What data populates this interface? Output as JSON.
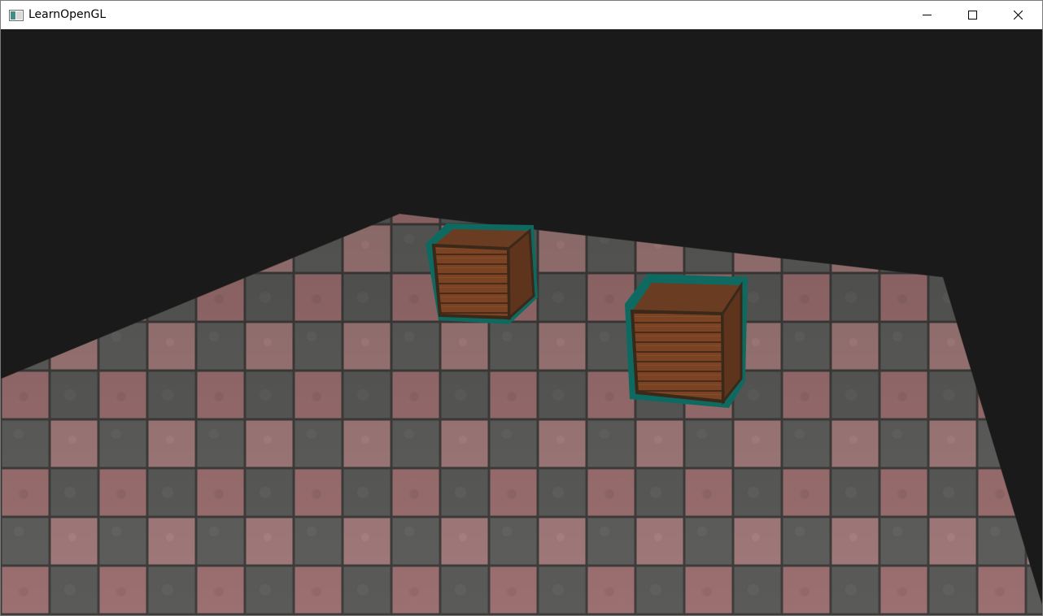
{
  "window": {
    "title": "LearnOpenGL",
    "icon": "app-window-icon",
    "controls": [
      "minimize-icon",
      "maximize-icon",
      "close-icon"
    ]
  },
  "scene": {
    "clear_color": "#1a1a1a",
    "outline_color": "#0e6a60",
    "floor_texture": "stone-tile-checker",
    "crate_texture": "wooden-crate",
    "object_count": 2
  }
}
